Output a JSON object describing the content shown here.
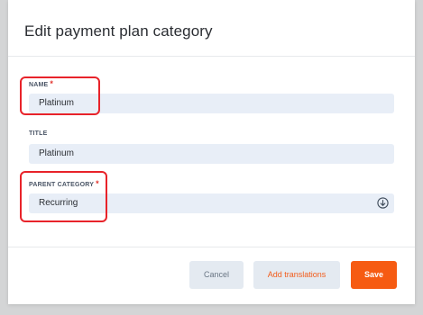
{
  "dialog": {
    "title": "Edit payment plan category"
  },
  "fields": {
    "name": {
      "label": "NAME",
      "required_mark": "*",
      "value": "Platinum"
    },
    "title": {
      "label": "TITLE",
      "value": "Platinum"
    },
    "parent_category": {
      "label": "PARENT CATEGORY",
      "required_mark": "*",
      "value": "Recurring",
      "icon": "chevron-down-circle-icon"
    }
  },
  "buttons": {
    "cancel": "Cancel",
    "add_translations": "Add translations",
    "save": "Save"
  },
  "colors": {
    "accent": "#f65b12",
    "highlight": "#e8232a",
    "input_bg": "#e8eef7",
    "required": "#e2342d"
  }
}
